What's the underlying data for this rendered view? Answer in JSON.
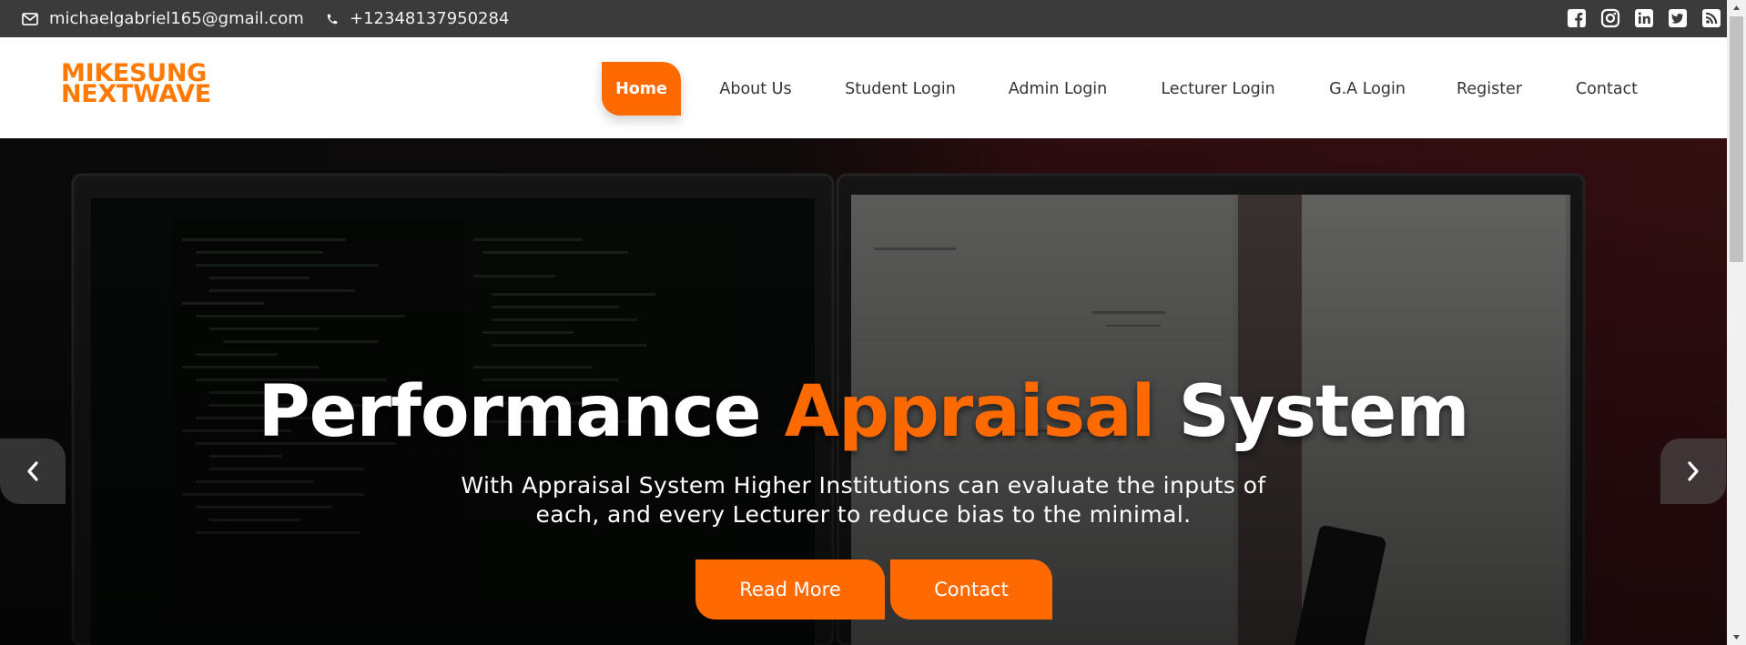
{
  "topbar": {
    "email": "michaelgabriel165@gmail.com",
    "phone": "+12348137950284",
    "socials": [
      "facebook-icon",
      "instagram-icon",
      "linkedin-icon",
      "twitter-icon",
      "rss-icon"
    ]
  },
  "brand": {
    "line1": "MIKESUNG",
    "line2": "NEXTWAVE"
  },
  "nav": {
    "items": [
      {
        "label": "Home",
        "active": true
      },
      {
        "label": "About Us"
      },
      {
        "label": "Student Login"
      },
      {
        "label": "Admin Login"
      },
      {
        "label": "Lecturer Login"
      },
      {
        "label": "G.A Login"
      },
      {
        "label": "Register"
      },
      {
        "label": "Contact"
      }
    ]
  },
  "hero": {
    "title_part1": "Performance",
    "title_accent": "Appraisal",
    "title_part2": "System",
    "subtitle": "With Appraisal System Higher Institutions can evaluate the inputs of each, and every Lecturer to reduce bias to the minimal.",
    "buttons": {
      "read_more": "Read More",
      "contact": "Contact"
    }
  },
  "colors": {
    "accent": "#ff6a00",
    "topbar_bg": "#3b3b3b",
    "logo": "#ff7a05"
  }
}
